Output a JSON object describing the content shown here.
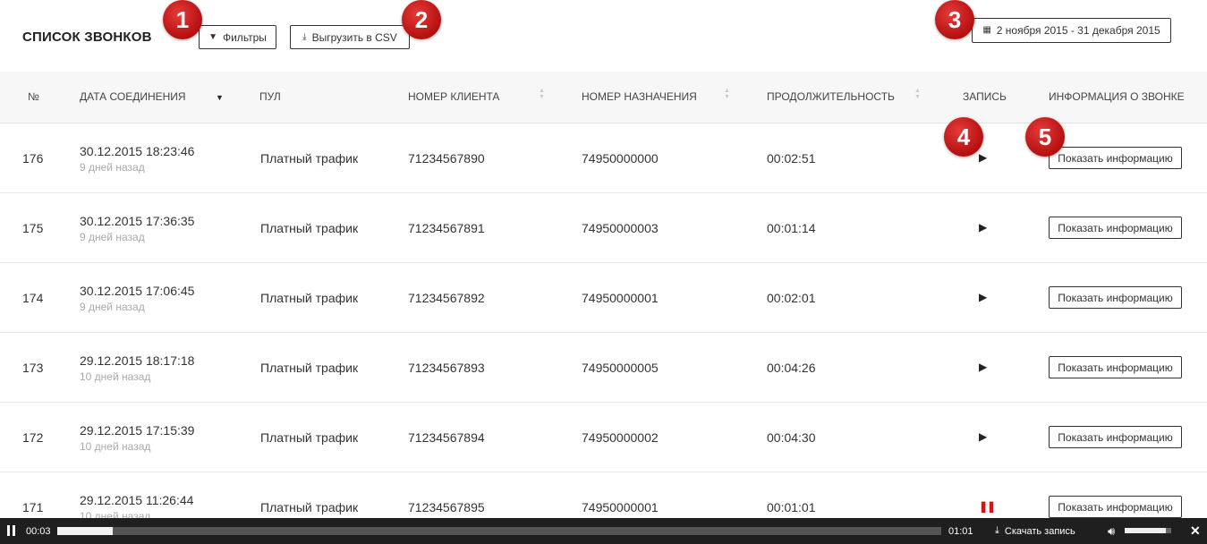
{
  "header": {
    "title": "СПИСОК ЗВОНКОВ",
    "filter_label": "Фильтры",
    "csv_label": "Выгрузить в CSV",
    "date_range": "2 ноября 2015 - 31 декабря 2015"
  },
  "badges": [
    "1",
    "2",
    "3",
    "4",
    "5"
  ],
  "columns": {
    "num": "№",
    "date": "ДАТА СОЕДИНЕНИЯ",
    "pool": "ПУЛ",
    "client": "НОМЕР КЛИЕНТА",
    "dest": "НОМЕР НАЗНАЧЕНИЯ",
    "duration": "ПРОДОЛЖИТЕЛЬНОСТЬ",
    "record": "ЗАПИСЬ",
    "info": "ИНФОРМАЦИЯ О ЗВОНКЕ"
  },
  "rows": [
    {
      "num": "176",
      "date": "30.12.2015 18:23:46",
      "ago": "9 дней назад",
      "pool": "Платный трафик",
      "client": "71234567890",
      "dest": "74950000000",
      "duration": "00:02:51",
      "record_state": "play",
      "record_icon": "▶",
      "info": "Показать информацию"
    },
    {
      "num": "175",
      "date": "30.12.2015 17:36:35",
      "ago": "9 дней назад",
      "pool": "Платный трафик",
      "client": "71234567891",
      "dest": "74950000003",
      "duration": "00:01:14",
      "record_state": "play",
      "record_icon": "▶",
      "info": "Показать информацию"
    },
    {
      "num": "174",
      "date": "30.12.2015 17:06:45",
      "ago": "9 дней назад",
      "pool": "Платный трафик",
      "client": "71234567892",
      "dest": "74950000001",
      "duration": "00:02:01",
      "record_state": "play",
      "record_icon": "▶",
      "info": "Показать информацию"
    },
    {
      "num": "173",
      "date": "29.12.2015 18:17:18",
      "ago": "10 дней назад",
      "pool": "Платный трафик",
      "client": "71234567893",
      "dest": "74950000005",
      "duration": "00:04:26",
      "record_state": "play",
      "record_icon": "▶",
      "info": "Показать информацию"
    },
    {
      "num": "172",
      "date": "29.12.2015 17:15:39",
      "ago": "10 дней назад",
      "pool": "Платный трафик",
      "client": "71234567894",
      "dest": "74950000002",
      "duration": "00:04:30",
      "record_state": "play",
      "record_icon": "▶",
      "info": "Показать информацию"
    },
    {
      "num": "171",
      "date": "29.12.2015 11:26:44",
      "ago": "10 дней назад",
      "pool": "Платный трафик",
      "client": "71234567895",
      "dest": "74950000001",
      "duration": "00:01:01",
      "record_state": "pause",
      "record_icon": "❚❚",
      "info": "Показать информацию"
    }
  ],
  "player": {
    "current": "00:03",
    "total": "01:01",
    "progress_fraction": 0.063,
    "download_label": "Скачать запись",
    "volume_fraction": 0.88
  },
  "colors": {
    "accent_red": "#c51414",
    "player_bg": "#1f1f1f"
  }
}
